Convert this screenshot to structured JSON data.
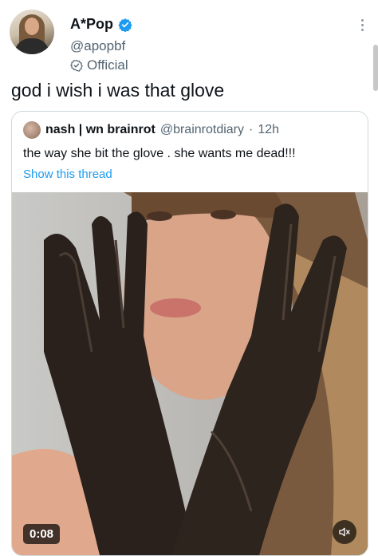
{
  "tweet": {
    "author": {
      "display_name": "A*Pop",
      "handle": "@apopbf",
      "label": "Official",
      "verified": true
    },
    "text": "god i wish i was that glove",
    "quote": {
      "author_name": "nash | wn brainrot",
      "handle": "@brainrotdiary",
      "separator": "·",
      "time": "12h",
      "text": "the way she bit the glove . she wants me dead!!!",
      "show_thread": "Show this thread",
      "video": {
        "duration": "0:08",
        "muted": true
      }
    }
  },
  "colors": {
    "text": "#0f1419",
    "secondary": "#536471",
    "link": "#1d9bf0",
    "verified_badge": "#1d9bf0",
    "border": "#cfd9de"
  },
  "icons": [
    "verified-badge-icon",
    "official-check-icon",
    "more-icon",
    "mute-icon"
  ]
}
